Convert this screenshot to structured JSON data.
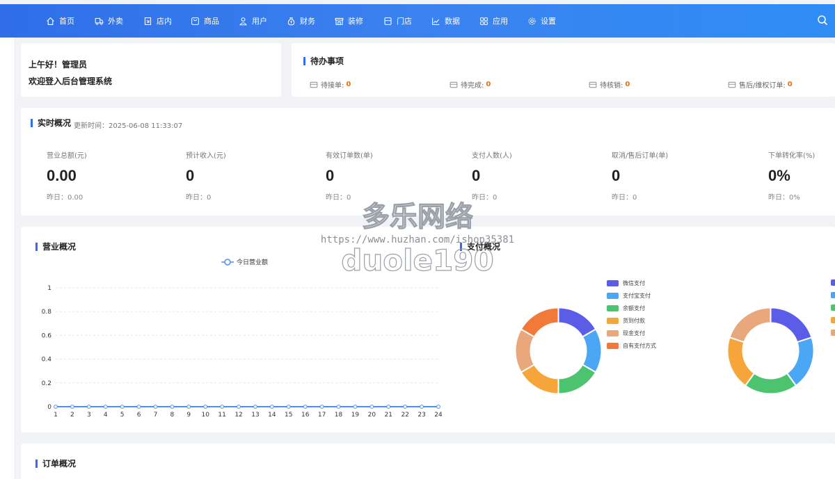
{
  "nav": {
    "items": [
      {
        "label": "首页",
        "icon": "home-icon"
      },
      {
        "label": "外卖",
        "icon": "delivery-icon"
      },
      {
        "label": "店内",
        "icon": "store-inside-icon"
      },
      {
        "label": "商品",
        "icon": "product-icon"
      },
      {
        "label": "用户",
        "icon": "user-icon"
      },
      {
        "label": "财务",
        "icon": "money-bag-icon"
      },
      {
        "label": "装修",
        "icon": "shop-decor-icon"
      },
      {
        "label": "门店",
        "icon": "storefront-icon"
      },
      {
        "label": "数据",
        "icon": "chart-icon"
      },
      {
        "label": "应用",
        "icon": "apps-grid-icon"
      },
      {
        "label": "设置",
        "icon": "gear-icon"
      }
    ],
    "search_icon": "search-icon"
  },
  "welcome": {
    "greeting": "上午好！管理员",
    "message": "欢迎登入后台管理系统"
  },
  "todo": {
    "title": "待办事项",
    "items": [
      {
        "label": "待接单:",
        "count": "0"
      },
      {
        "label": "待完成:",
        "count": "0"
      },
      {
        "label": "待核销:",
        "count": "0"
      },
      {
        "label": "售后/维权订单:",
        "count": "0"
      }
    ]
  },
  "realtime": {
    "title": "实时概况",
    "update_time": "更新时间：2025-06-08 11:33:07",
    "stats": [
      {
        "label": "营业总额(元)",
        "value": "0.00",
        "yesterday": "昨日：0.00"
      },
      {
        "label": "预计收入(元)",
        "value": "0",
        "yesterday": "昨日：0"
      },
      {
        "label": "有效订单数(单)",
        "value": "0",
        "yesterday": "昨日：0"
      },
      {
        "label": "支付人数(人)",
        "value": "0",
        "yesterday": "昨日：0"
      },
      {
        "label": "取消/售后订单(单)",
        "value": "0",
        "yesterday": "昨日：0"
      },
      {
        "label": "下单转化率(%)",
        "value": "0%",
        "yesterday": "昨日：0%"
      }
    ]
  },
  "business": {
    "title": "营业概况"
  },
  "payment": {
    "title": "支付概况"
  },
  "orders": {
    "title": "订单概况"
  },
  "watermark": {
    "line1": "多乐网络",
    "line2": "https://www.huzhan.com/ishop35381",
    "line3": "duole190"
  },
  "colors": {
    "nav_bg": "#2f6ee8",
    "accent": "#2f6ee8",
    "count": "#e8700c"
  },
  "chart_data": [
    {
      "type": "line",
      "title": "",
      "legend": [
        "今日营业额"
      ],
      "legend_position": "top-center",
      "x": [
        1,
        2,
        3,
        4,
        5,
        6,
        7,
        8,
        9,
        10,
        11,
        12,
        13,
        14,
        15,
        16,
        17,
        18,
        19,
        20,
        21,
        22,
        23,
        24
      ],
      "series": [
        {
          "name": "今日营业额",
          "values": [
            0,
            0,
            0,
            0,
            0,
            0,
            0,
            0,
            0,
            0,
            0,
            0,
            0,
            0,
            0,
            0,
            0,
            0,
            0,
            0,
            0,
            0,
            0,
            0
          ],
          "color": "#4a8ff0"
        }
      ],
      "ylim": [
        0,
        1
      ],
      "yticks": [
        "0",
        "0.2",
        "0.4",
        "0.6",
        "0.8",
        "1"
      ],
      "grid": true
    },
    {
      "type": "pie",
      "donut": true,
      "legend_position": "right",
      "categories": [
        "微信支付",
        "支付宝支付",
        "余额支付",
        "货到付款",
        "现金支付",
        "自有支付方式"
      ],
      "values": [
        1,
        1,
        1,
        1,
        1,
        1
      ],
      "colors": [
        "#5b5ce8",
        "#4ba6f5",
        "#4cc46f",
        "#f5a53a",
        "#e8a87c",
        "#f27a38"
      ]
    },
    {
      "type": "pie",
      "donut": true,
      "legend_position": "right",
      "values": [
        1,
        1,
        1,
        1,
        1
      ],
      "colors": [
        "#5b5ce8",
        "#4ba6f5",
        "#4cc46f",
        "#f5a53a",
        "#e8a87c"
      ]
    }
  ]
}
